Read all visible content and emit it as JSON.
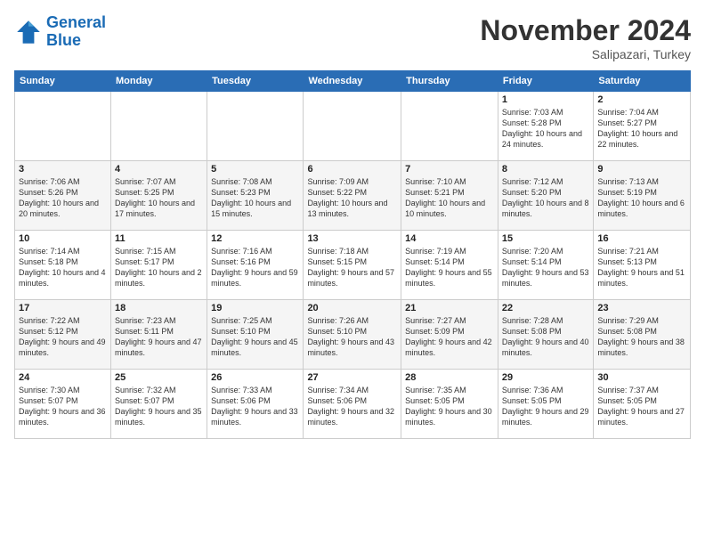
{
  "logo": {
    "line1": "General",
    "line2": "Blue"
  },
  "header": {
    "title": "November 2024",
    "subtitle": "Salipazari, Turkey"
  },
  "weekdays": [
    "Sunday",
    "Monday",
    "Tuesday",
    "Wednesday",
    "Thursday",
    "Friday",
    "Saturday"
  ],
  "weeks": [
    [
      {
        "day": "",
        "info": ""
      },
      {
        "day": "",
        "info": ""
      },
      {
        "day": "",
        "info": ""
      },
      {
        "day": "",
        "info": ""
      },
      {
        "day": "",
        "info": ""
      },
      {
        "day": "1",
        "info": "Sunrise: 7:03 AM\nSunset: 5:28 PM\nDaylight: 10 hours and 24 minutes."
      },
      {
        "day": "2",
        "info": "Sunrise: 7:04 AM\nSunset: 5:27 PM\nDaylight: 10 hours and 22 minutes."
      }
    ],
    [
      {
        "day": "3",
        "info": "Sunrise: 7:06 AM\nSunset: 5:26 PM\nDaylight: 10 hours and 20 minutes."
      },
      {
        "day": "4",
        "info": "Sunrise: 7:07 AM\nSunset: 5:25 PM\nDaylight: 10 hours and 17 minutes."
      },
      {
        "day": "5",
        "info": "Sunrise: 7:08 AM\nSunset: 5:23 PM\nDaylight: 10 hours and 15 minutes."
      },
      {
        "day": "6",
        "info": "Sunrise: 7:09 AM\nSunset: 5:22 PM\nDaylight: 10 hours and 13 minutes."
      },
      {
        "day": "7",
        "info": "Sunrise: 7:10 AM\nSunset: 5:21 PM\nDaylight: 10 hours and 10 minutes."
      },
      {
        "day": "8",
        "info": "Sunrise: 7:12 AM\nSunset: 5:20 PM\nDaylight: 10 hours and 8 minutes."
      },
      {
        "day": "9",
        "info": "Sunrise: 7:13 AM\nSunset: 5:19 PM\nDaylight: 10 hours and 6 minutes."
      }
    ],
    [
      {
        "day": "10",
        "info": "Sunrise: 7:14 AM\nSunset: 5:18 PM\nDaylight: 10 hours and 4 minutes."
      },
      {
        "day": "11",
        "info": "Sunrise: 7:15 AM\nSunset: 5:17 PM\nDaylight: 10 hours and 2 minutes."
      },
      {
        "day": "12",
        "info": "Sunrise: 7:16 AM\nSunset: 5:16 PM\nDaylight: 9 hours and 59 minutes."
      },
      {
        "day": "13",
        "info": "Sunrise: 7:18 AM\nSunset: 5:15 PM\nDaylight: 9 hours and 57 minutes."
      },
      {
        "day": "14",
        "info": "Sunrise: 7:19 AM\nSunset: 5:14 PM\nDaylight: 9 hours and 55 minutes."
      },
      {
        "day": "15",
        "info": "Sunrise: 7:20 AM\nSunset: 5:14 PM\nDaylight: 9 hours and 53 minutes."
      },
      {
        "day": "16",
        "info": "Sunrise: 7:21 AM\nSunset: 5:13 PM\nDaylight: 9 hours and 51 minutes."
      }
    ],
    [
      {
        "day": "17",
        "info": "Sunrise: 7:22 AM\nSunset: 5:12 PM\nDaylight: 9 hours and 49 minutes."
      },
      {
        "day": "18",
        "info": "Sunrise: 7:23 AM\nSunset: 5:11 PM\nDaylight: 9 hours and 47 minutes."
      },
      {
        "day": "19",
        "info": "Sunrise: 7:25 AM\nSunset: 5:10 PM\nDaylight: 9 hours and 45 minutes."
      },
      {
        "day": "20",
        "info": "Sunrise: 7:26 AM\nSunset: 5:10 PM\nDaylight: 9 hours and 43 minutes."
      },
      {
        "day": "21",
        "info": "Sunrise: 7:27 AM\nSunset: 5:09 PM\nDaylight: 9 hours and 42 minutes."
      },
      {
        "day": "22",
        "info": "Sunrise: 7:28 AM\nSunset: 5:08 PM\nDaylight: 9 hours and 40 minutes."
      },
      {
        "day": "23",
        "info": "Sunrise: 7:29 AM\nSunset: 5:08 PM\nDaylight: 9 hours and 38 minutes."
      }
    ],
    [
      {
        "day": "24",
        "info": "Sunrise: 7:30 AM\nSunset: 5:07 PM\nDaylight: 9 hours and 36 minutes."
      },
      {
        "day": "25",
        "info": "Sunrise: 7:32 AM\nSunset: 5:07 PM\nDaylight: 9 hours and 35 minutes."
      },
      {
        "day": "26",
        "info": "Sunrise: 7:33 AM\nSunset: 5:06 PM\nDaylight: 9 hours and 33 minutes."
      },
      {
        "day": "27",
        "info": "Sunrise: 7:34 AM\nSunset: 5:06 PM\nDaylight: 9 hours and 32 minutes."
      },
      {
        "day": "28",
        "info": "Sunrise: 7:35 AM\nSunset: 5:05 PM\nDaylight: 9 hours and 30 minutes."
      },
      {
        "day": "29",
        "info": "Sunrise: 7:36 AM\nSunset: 5:05 PM\nDaylight: 9 hours and 29 minutes."
      },
      {
        "day": "30",
        "info": "Sunrise: 7:37 AM\nSunset: 5:05 PM\nDaylight: 9 hours and 27 minutes."
      }
    ]
  ]
}
